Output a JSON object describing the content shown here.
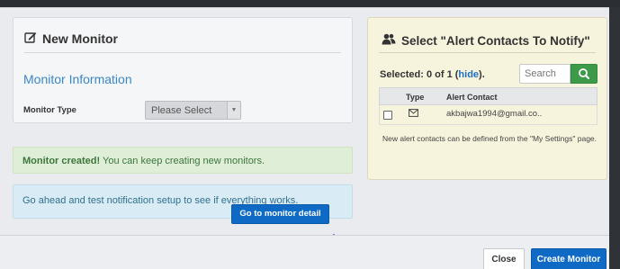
{
  "new_monitor_panel": {
    "title": "New Monitor",
    "section_title": "Monitor Information",
    "monitor_type_label": "Monitor Type",
    "monitor_type_value": "Please Select"
  },
  "alerts": {
    "success_bold": "Monitor created!",
    "success_text": " You can keep creating new monitors.",
    "info_text": "Go ahead and test notification setup to see if everything works.",
    "detail_button": "Go to monitor detail"
  },
  "alert_contacts_panel": {
    "title": "Select \"Alert Contacts To Notify\"",
    "selected_prefix": "Selected: 0 of 1 (",
    "hide_link": "hide",
    "selected_suffix": ").",
    "search_placeholder": "Search",
    "columns": [
      "Type",
      "Alert Contact"
    ],
    "contacts": [
      {
        "type_icon": "envelope-icon",
        "email": "akbajwa1994@gmail.co.."
      }
    ],
    "note": "New alert contacts can be defined from the \"My Settings\" page."
  },
  "footer": {
    "close_label": "Close",
    "create_label": "Create Monitor"
  },
  "colors": {
    "primary": "#0f6ac6",
    "success_bg": "#dfeed6",
    "info_bg": "#d9ecf5",
    "search_green": "#3d9a49",
    "alert_panel_bg": "#f7f4dd",
    "annotation_arrow": "#1a2fb8"
  }
}
